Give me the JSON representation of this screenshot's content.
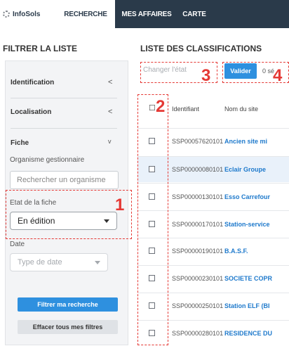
{
  "app": {
    "logo_text": "InfoSols"
  },
  "nav": {
    "tabs": [
      {
        "label": "RECHERCHE",
        "active": true
      },
      {
        "label": "MES AFFAIRES"
      },
      {
        "label": "CARTE"
      }
    ]
  },
  "filter": {
    "title": "FILTRER LA LISTE",
    "sections": [
      {
        "label": "Identification",
        "chevron": "<"
      },
      {
        "label": "Localisation",
        "chevron": "<"
      },
      {
        "label": "Fiche",
        "chevron": "v"
      }
    ],
    "organisme_label": "Organisme gestionnaire",
    "organisme_placeholder": "Rechercher un organisme",
    "etat_label": "Etat de la fiche",
    "etat_value": "En édition",
    "date_label": "Date",
    "date_value": "Type de date",
    "apply_button": "Filtrer ma recherche",
    "clear_button": "Effacer tous mes filtres"
  },
  "list": {
    "title": "LISTE DES CLASSIFICATIONS",
    "change_state_placeholder": "Changer l'état",
    "validate_button": "Valider",
    "selection_count": "0 sé",
    "headers": {
      "checkbox": "☐",
      "id": "Identifiant",
      "name": "Nom du site"
    },
    "rows": [
      {
        "id": "SSP00057620101",
        "name": "Ancien site mi"
      },
      {
        "id": "SSP00000080101",
        "name": "Eclair Groupe"
      },
      {
        "id": "SSP00000130101",
        "name": "Esso Carrefour"
      },
      {
        "id": "SSP00000170101",
        "name": "Station-service"
      },
      {
        "id": "SSP00000190101",
        "name": "B.A.S.F."
      },
      {
        "id": "SSP00000230101",
        "name": "SOCIETE COPR"
      },
      {
        "id": "SSP00000250101",
        "name": "Station ELF (BI"
      },
      {
        "id": "SSP00000280101",
        "name": "RESIDENCE DU"
      }
    ]
  },
  "annotations": [
    "1",
    "2",
    "3",
    "4"
  ],
  "colors": {
    "navbar": "#2a3a4a",
    "accent": "#2e90df",
    "annotation": "#e53935",
    "link": "#1f7acc"
  }
}
